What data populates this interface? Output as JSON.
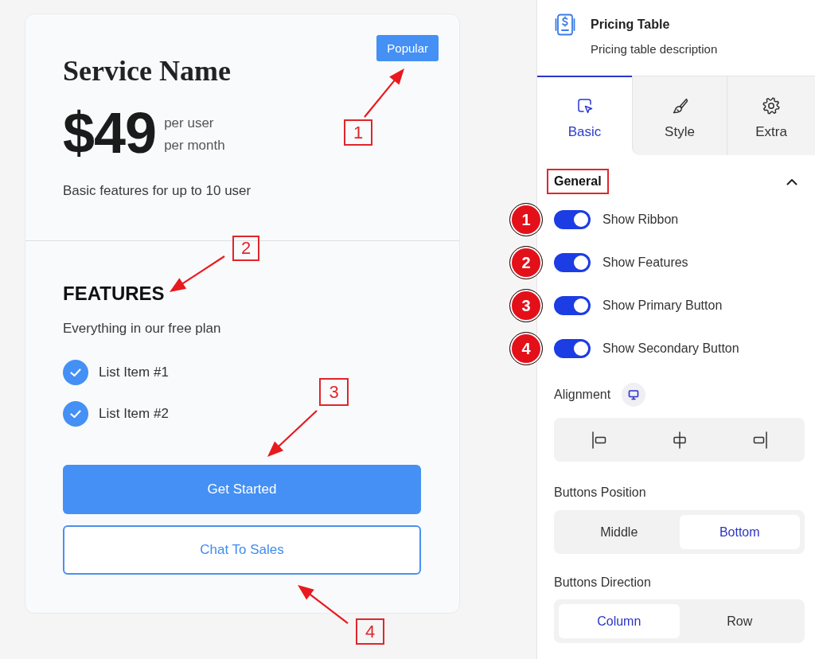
{
  "pricing_card": {
    "ribbon": "Popular",
    "title": "Service Name",
    "price": "$49",
    "price_period": [
      "per user",
      "per month"
    ],
    "description": "Basic features for up to 10 user",
    "features_title": "FEATURES",
    "features_subtitle": "Everything in our free plan",
    "features": [
      "List Item #1",
      "List Item #2"
    ],
    "primary_button": "Get Started",
    "secondary_button": "Chat To Sales"
  },
  "panel": {
    "title": "Pricing Table",
    "description": "Pricing table description",
    "tabs": [
      {
        "label": "Basic",
        "selected": true
      },
      {
        "label": "Style",
        "selected": false
      },
      {
        "label": "Extra",
        "selected": false
      }
    ],
    "section": {
      "title": "General",
      "expanded": true,
      "highlighted": true
    },
    "toggles": [
      {
        "label": "Show Ribbon",
        "on": true,
        "marker": "1"
      },
      {
        "label": "Show Features",
        "on": true,
        "marker": "2"
      },
      {
        "label": "Show Primary Button",
        "on": true,
        "marker": "3"
      },
      {
        "label": "Show Secondary Button",
        "on": true,
        "marker": "4"
      }
    ],
    "alignment": {
      "label": "Alignment",
      "options": [
        {
          "kind": "left",
          "selected": false
        },
        {
          "kind": "center",
          "selected": false
        },
        {
          "kind": "right",
          "selected": false
        }
      ]
    },
    "buttons_position": {
      "label": "Buttons Position",
      "options": [
        {
          "label": "Middle",
          "selected": false
        },
        {
          "label": "Bottom",
          "selected": true
        }
      ]
    },
    "buttons_direction": {
      "label": "Buttons Direction",
      "options": [
        {
          "label": "Column",
          "selected": true
        },
        {
          "label": "Row",
          "selected": false
        }
      ]
    }
  },
  "annotations": [
    {
      "label": "1"
    },
    {
      "label": "2"
    },
    {
      "label": "3"
    },
    {
      "label": "4"
    }
  ]
}
